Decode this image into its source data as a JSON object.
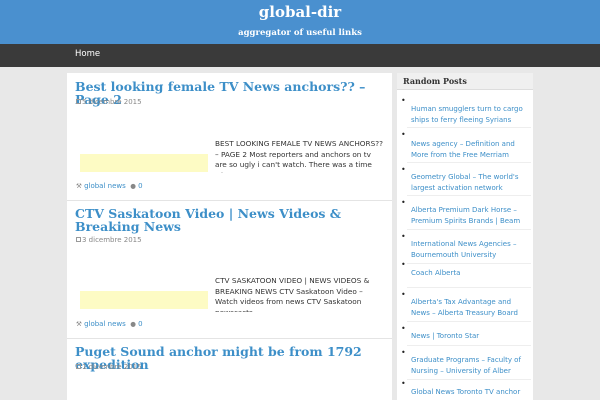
{
  "site": {
    "title": "global-dir",
    "description": "aggregator of useful links"
  },
  "nav": {
    "home": "Home"
  },
  "posts": [
    {
      "title": "Best looking female TV News anchors?? – Page 2",
      "date": "5 dicembre 2015",
      "excerpt": "BEST LOOKING FEMALE TV NEWS ANCHORS?? – PAGE 2 Most reporters and anchors on tv are so ugly i can't watch. There was a time when a",
      "category": "global news",
      "comments": "0"
    },
    {
      "title": "CTV Saskatoon Video | News Videos & Breaking News",
      "date": "3 dicembre 2015",
      "excerpt": "CTV SASKATOON VIDEO | NEWS VIDEOS & BREAKING NEWS CTV Saskatoon Video – Watch videos from news CTV Saskatoon newscasts. ",
      "category": "global news",
      "comments": "0"
    },
    {
      "title": "Puget Sound anchor might be from 1792 expedition",
      "date": "1 dicembre 2015"
    }
  ],
  "sidebar": {
    "title": "Random Posts",
    "items": [
      "Human smugglers turn to cargo ships to ferry fleeing Syrians",
      "News agency – Definition and More from the Free Merriam",
      "Geometry Global – The world's largest activation network",
      "Alberta Premium Dark Horse – Premium Spirits Brands | Beam",
      "International News Agencies – Bournemouth University",
      "Coach Alberta",
      "Alberta's Tax Advantage and News – Alberta Treasury Board",
      "News | Toronto Star",
      "Graduate Programs – Faculty of Nursing – University of Alber",
      "Global News Toronto TV anchor"
    ]
  },
  "colors": {
    "header": "#4a90cf",
    "navbar": "#3a3a3a",
    "link": "#3d8fc8",
    "thumb": "#fdfbc4"
  }
}
